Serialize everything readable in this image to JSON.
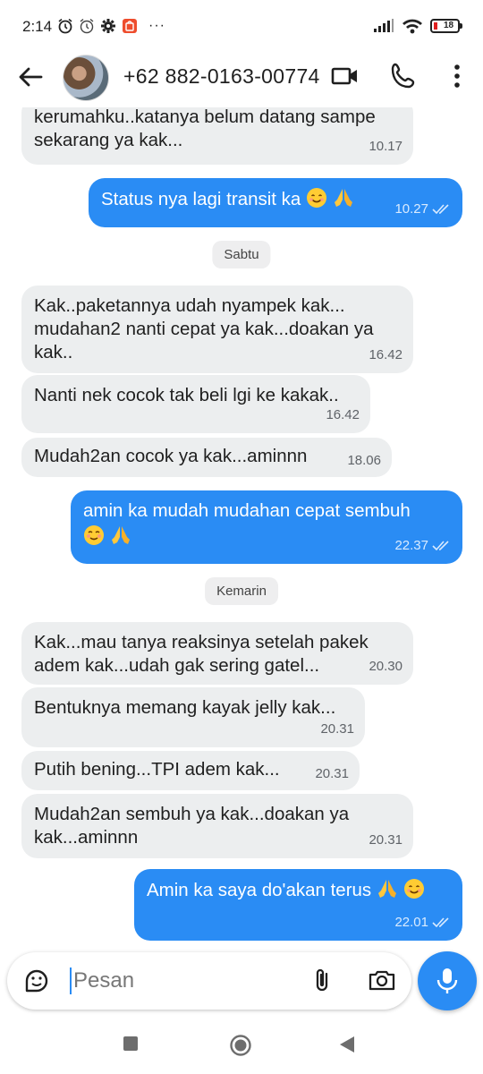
{
  "status_bar": {
    "time": "2:14",
    "battery": "18",
    "more": "···"
  },
  "header": {
    "contact": "+62 882-0163-00774"
  },
  "chat": {
    "messages": [
      {
        "dir": "in",
        "text": "kerumahku..katanya belum datang sampe sekarang ya kak...",
        "time": "10.17"
      },
      {
        "dir": "out",
        "text": "Status nya lagi transit ka",
        "time": "10.27",
        "emoji": [
          "smile-emoji",
          "pray-emoji"
        ]
      },
      {
        "dir": "in",
        "text": "Kak..paketannya udah nyampek kak... mudahan2 nanti cepat ya kak...doakan ya kak..",
        "time": "16.42"
      },
      {
        "dir": "in",
        "text": "Nanti nek cocok tak beli lgi ke kakak..",
        "time": "16.42"
      },
      {
        "dir": "in",
        "text": "Mudah2an cocok ya kak...aminnn",
        "time": "18.06"
      },
      {
        "dir": "out",
        "text": "amin ka mudah mudahan cepat sembuh",
        "time": "22.37",
        "emoji": [
          "blush-emoji",
          "pray-emoji"
        ]
      },
      {
        "dir": "in",
        "text": "Kak...mau tanya reaksinya setelah pakek adem kak...udah gak sering gatel...",
        "time": "20.30"
      },
      {
        "dir": "in",
        "text": "Bentuknya memang kayak jelly kak...",
        "time": "20.31"
      },
      {
        "dir": "in",
        "text": "Putih bening...TPI adem kak...",
        "time": "20.31"
      },
      {
        "dir": "in",
        "text": "Mudah2an sembuh ya kak...doakan ya kak...aminnn",
        "time": "20.31"
      },
      {
        "dir": "out",
        "text": "Amin ka saya do'akan terus",
        "time": "22.01",
        "emoji": [
          "pray-emoji",
          "smile-emoji"
        ]
      }
    ],
    "dates": [
      "Sabtu",
      "Kemarin"
    ]
  },
  "composer": {
    "placeholder": "Pesan"
  },
  "colors": {
    "accent": "#2a8cf4",
    "incoming_bubble": "#eceeef"
  }
}
